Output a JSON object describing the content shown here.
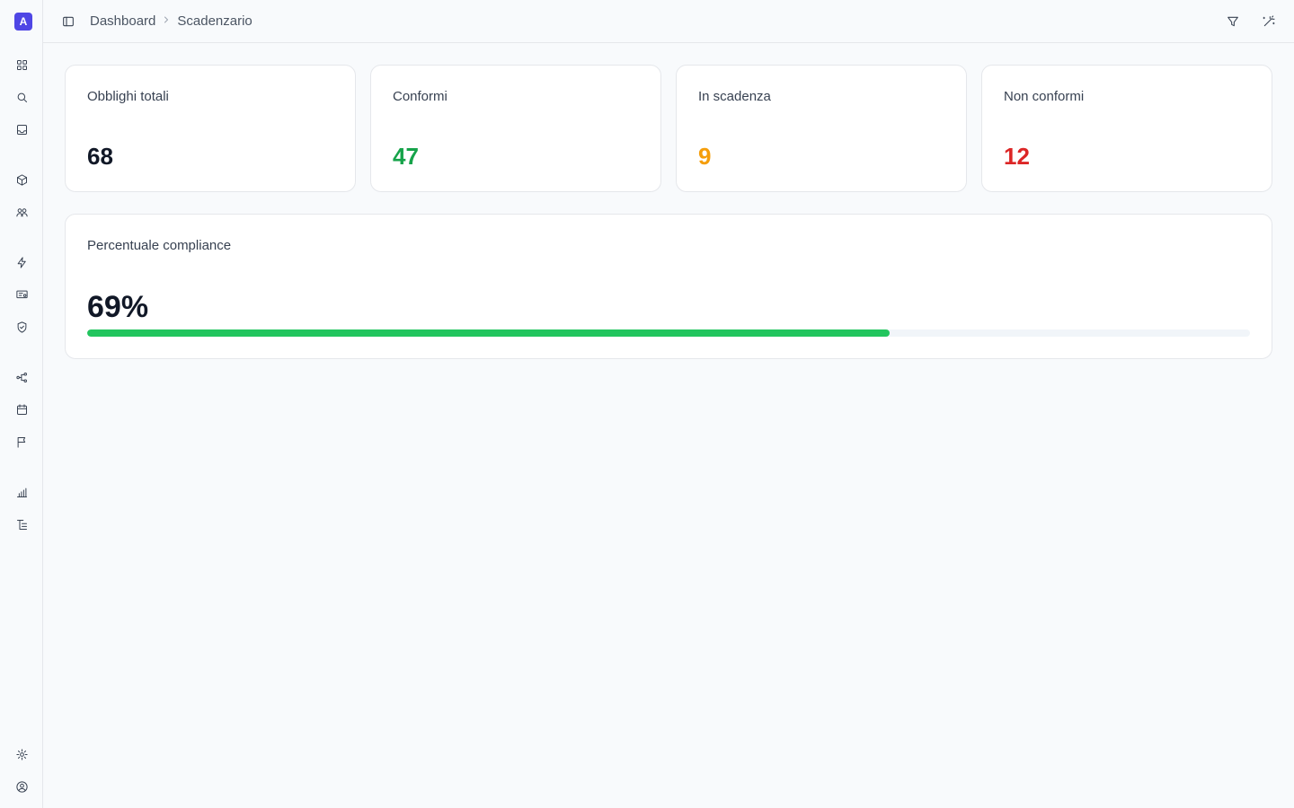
{
  "app": {
    "logo_letter": "A"
  },
  "breadcrumb": {
    "root": "Dashboard",
    "current": "Scadenzario"
  },
  "stats": [
    {
      "label": "Obblighi totali",
      "value": "68",
      "color": "#111827"
    },
    {
      "label": "Conformi",
      "value": "47",
      "color": "#16a34a"
    },
    {
      "label": "In scadenza",
      "value": "9",
      "color": "#f59e0b"
    },
    {
      "label": "Non conformi",
      "value": "12",
      "color": "#dc2626"
    }
  ],
  "compliance": {
    "label": "Percentuale compliance",
    "value_text": "69%",
    "fraction": 0.69,
    "bar_color": "#22c55e"
  },
  "sidebar_icons": [
    "dashboard-grid-icon",
    "search-icon",
    "inbox-icon",
    "cube-icon",
    "users-icon",
    "lightning-icon",
    "certificate-icon",
    "shield-check-icon",
    "workflow-icon",
    "calendar-icon",
    "flag-icon",
    "bar-chart-icon",
    "document-tree-icon",
    "settings-icon",
    "user-circle-icon"
  ]
}
